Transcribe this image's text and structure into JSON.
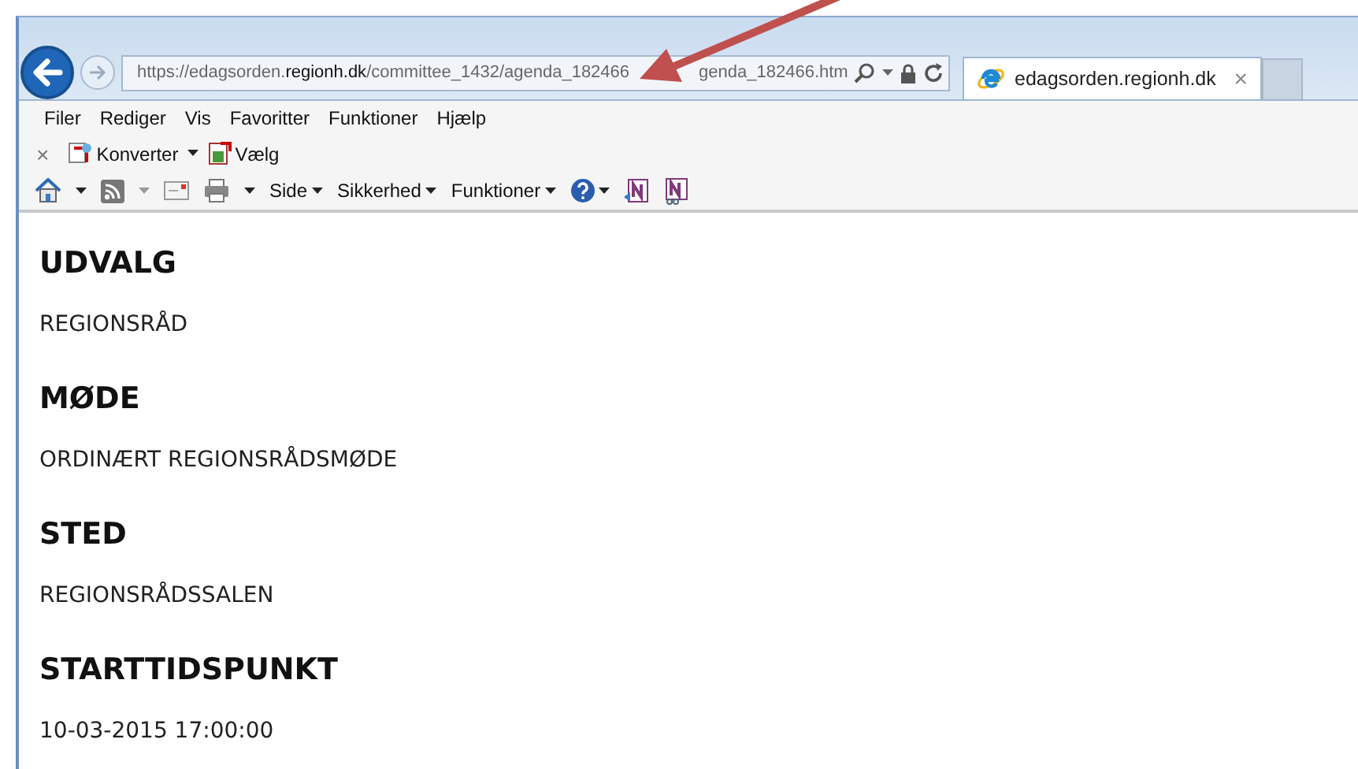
{
  "browser": {
    "address": {
      "url": "https://edagsorden.**regionh.dk**/committee_1432/agenda_182466",
      "url_tail": "genda_182466.htm"
    },
    "tab": {
      "title": "edagsorden.regionh.dk",
      "close": "×",
      "selected": true
    }
  },
  "menu": [
    "Filer",
    "Rediger",
    "Vis",
    "Favoritter",
    "Funktioner",
    "Hjælp"
  ],
  "command_bar": {
    "close": "×",
    "convert": "Konverter",
    "select": "Vælg"
  },
  "toolbar": [
    "Side",
    "Sikkerhed",
    "Funktioner"
  ],
  "page": {
    "sections": [
      {
        "heading": "UDVALG",
        "text": "REGIONSRÅD"
      },
      {
        "heading": "MØDE",
        "text": "ORDINÆRT REGIONSRÅDSMØDE"
      },
      {
        "heading": "STED",
        "text": "REGIONSRÅDSSALEN"
      },
      {
        "heading": "STARTTIDSPUNKT",
        "text": "10-03-2015 17:00:00"
      }
    ]
  }
}
